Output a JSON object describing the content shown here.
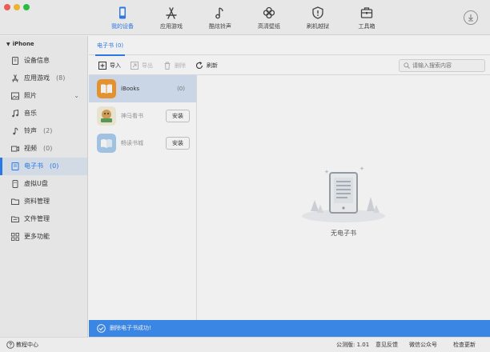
{
  "toolbar": {
    "items": [
      {
        "label": "我的设备",
        "icon": "phone-icon",
        "active": true
      },
      {
        "label": "应用游戏",
        "icon": "app-store-icon"
      },
      {
        "label": "酷炫铃声",
        "icon": "music-note-icon"
      },
      {
        "label": "高清壁纸",
        "icon": "flower-icon"
      },
      {
        "label": "刷机越狱",
        "icon": "shield-icon"
      },
      {
        "label": "工具箱",
        "icon": "toolbox-icon"
      }
    ],
    "download_icon": "download-icon"
  },
  "sidebar": {
    "device": "iPhone",
    "items": [
      {
        "label": "设备信息",
        "count": "",
        "icon": "device-info-icon"
      },
      {
        "label": "应用游戏",
        "count": "(8)",
        "icon": "app-store-icon"
      },
      {
        "label": "照片",
        "count": "",
        "icon": "photo-icon"
      },
      {
        "label": "音乐",
        "count": "",
        "icon": "music-icon"
      },
      {
        "label": "铃声",
        "count": "(2)",
        "icon": "ringtone-icon"
      },
      {
        "label": "视频",
        "count": "(0)",
        "icon": "video-icon"
      },
      {
        "label": "电子书",
        "count": "(0)",
        "icon": "ebook-icon",
        "active": true
      },
      {
        "label": "虚拟U盘",
        "count": "",
        "icon": "usb-drive-icon"
      },
      {
        "label": "资料管理",
        "count": "",
        "icon": "folder-icon"
      },
      {
        "label": "文件管理",
        "count": "",
        "icon": "file-manager-icon"
      },
      {
        "label": "更多功能",
        "count": "",
        "icon": "grid-icon"
      }
    ]
  },
  "main": {
    "tab": "电子书 (0)",
    "actions": {
      "import": "导入",
      "export": "导出",
      "delete": "删除",
      "refresh": "刷新"
    },
    "search_placeholder": "请输入搜索内容",
    "apps": [
      {
        "name": "iBooks",
        "count": "(0)",
        "icon": "ibooks-icon",
        "selected": true
      },
      {
        "name": "神马看书",
        "install": "安装",
        "icon": "shenma-icon"
      },
      {
        "name": "畅读书城",
        "install": "安装",
        "icon": "changdu-icon"
      }
    ],
    "empty_text": "无电子书"
  },
  "toast": {
    "text": "删除电子书成功!"
  },
  "status": {
    "help": "教程中心",
    "version": "公测版: 1.01",
    "feedback": "意见反馈",
    "wechat": "微信公众号",
    "update": "检查更新"
  },
  "colors": {
    "accent": "#2a7df1",
    "toast": "#3a8cf2"
  }
}
